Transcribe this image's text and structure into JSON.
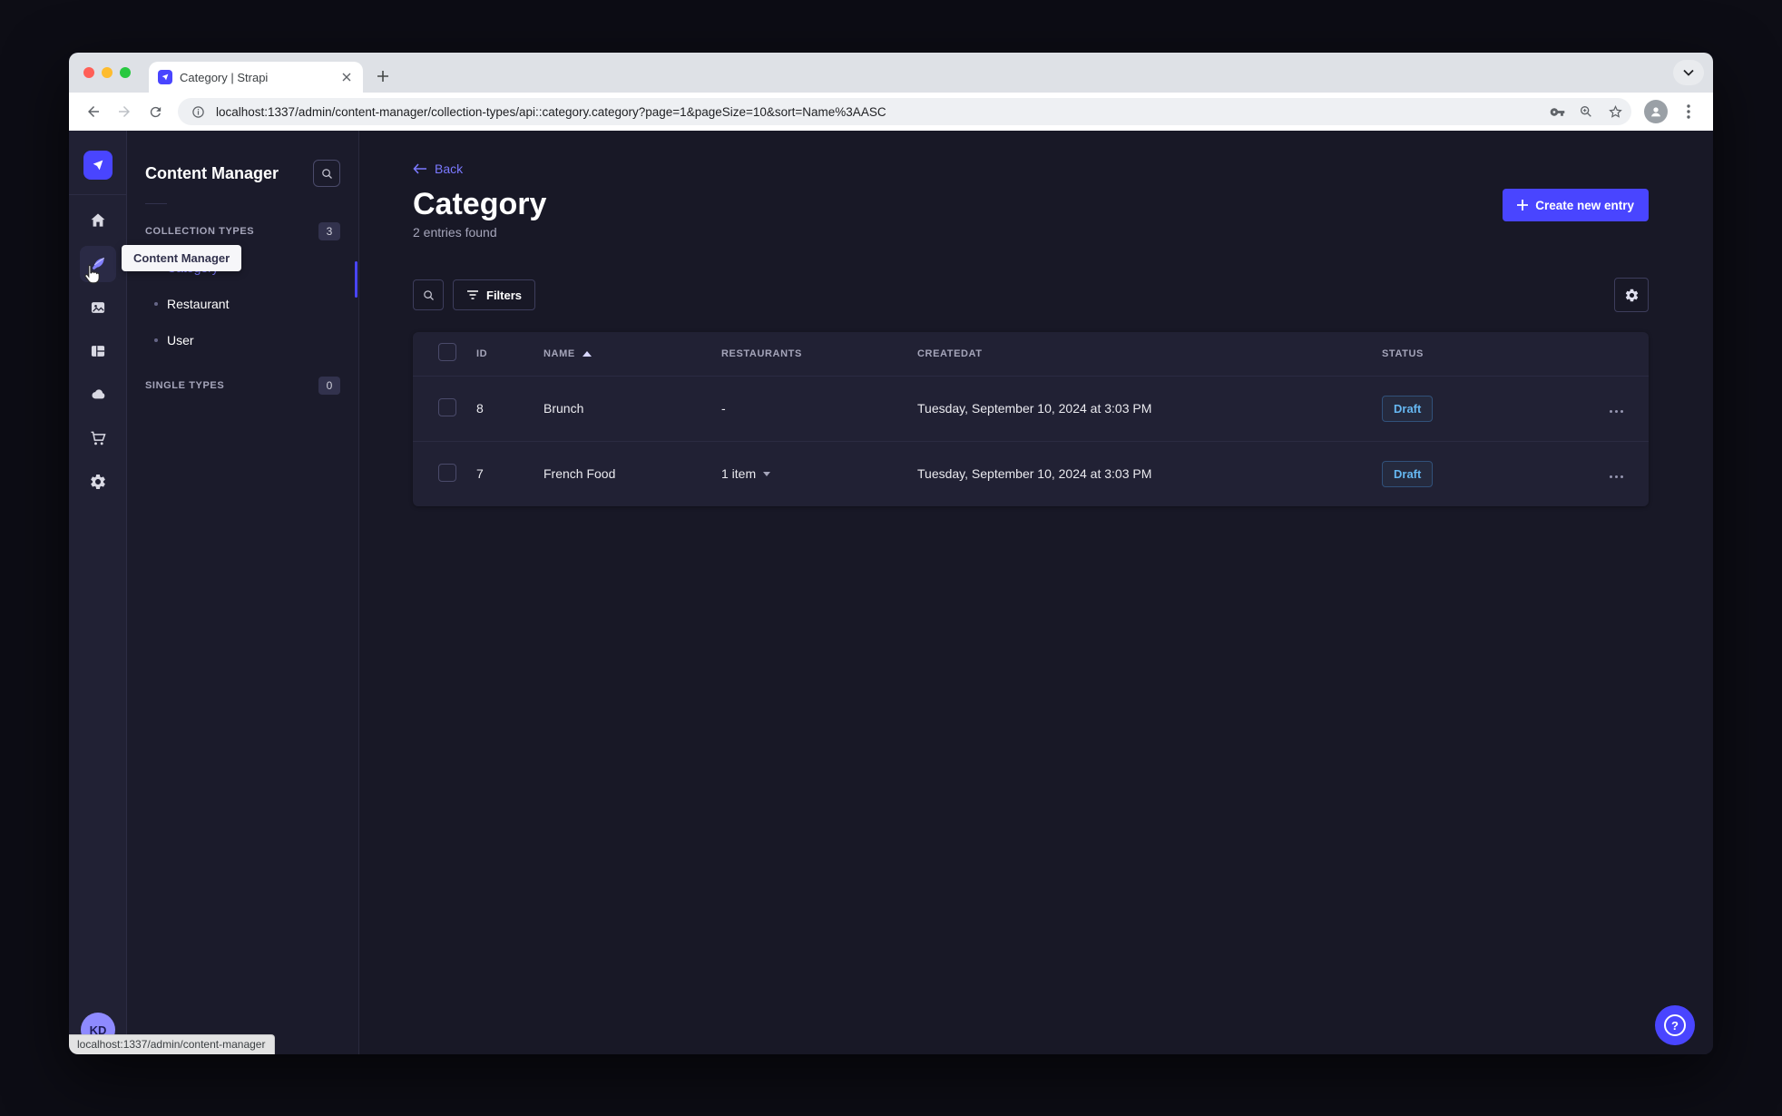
{
  "browser": {
    "tab_title": "Category | Strapi",
    "url": "localhost:1337/admin/content-manager/collection-types/api::category.category?page=1&pageSize=10&sort=Name%3AASC",
    "link_preview": "localhost:1337/admin/content-manager"
  },
  "navbar": {
    "tooltip": "Content Manager",
    "avatar_initials": "KD",
    "icons": [
      "strapi-logo",
      "home",
      "content-manager",
      "media-library",
      "content-type-builder",
      "cloud",
      "marketplace",
      "settings"
    ]
  },
  "subnav": {
    "title": "Content Manager",
    "search_icon": "magnifier",
    "collection_types": {
      "label": "COLLECTION TYPES",
      "badge": "3",
      "items": [
        {
          "label": "Category",
          "active": true
        },
        {
          "label": "Restaurant",
          "active": false
        },
        {
          "label": "User",
          "active": false
        }
      ]
    },
    "single_types": {
      "label": "SINGLE TYPES",
      "badge": "0"
    }
  },
  "main": {
    "back_label": "Back",
    "title": "Category",
    "subtitle": "2 entries found",
    "create_button_label": "Create new entry",
    "filters_label": "Filters",
    "table": {
      "headers": {
        "id": "ID",
        "name": "NAME",
        "restaurants": "RESTAURANTS",
        "createdat": "CREATEDAT",
        "status": "STATUS"
      },
      "sort": {
        "column": "NAME",
        "direction": "asc"
      },
      "rows": [
        {
          "id": "8",
          "name": "Brunch",
          "restaurants": "-",
          "createdat": "Tuesday, September 10, 2024 at 3:03 PM",
          "status": "Draft"
        },
        {
          "id": "7",
          "name": "French Food",
          "restaurants": "1 item",
          "createdat": "Tuesday, September 10, 2024 at 3:03 PM",
          "status": "Draft"
        }
      ]
    }
  },
  "colors": {
    "primary": "#4945ff",
    "primary_light": "#7b79ff",
    "draft_text": "#66b7f1",
    "app_bg": "#181826",
    "panel_bg": "#212134"
  }
}
